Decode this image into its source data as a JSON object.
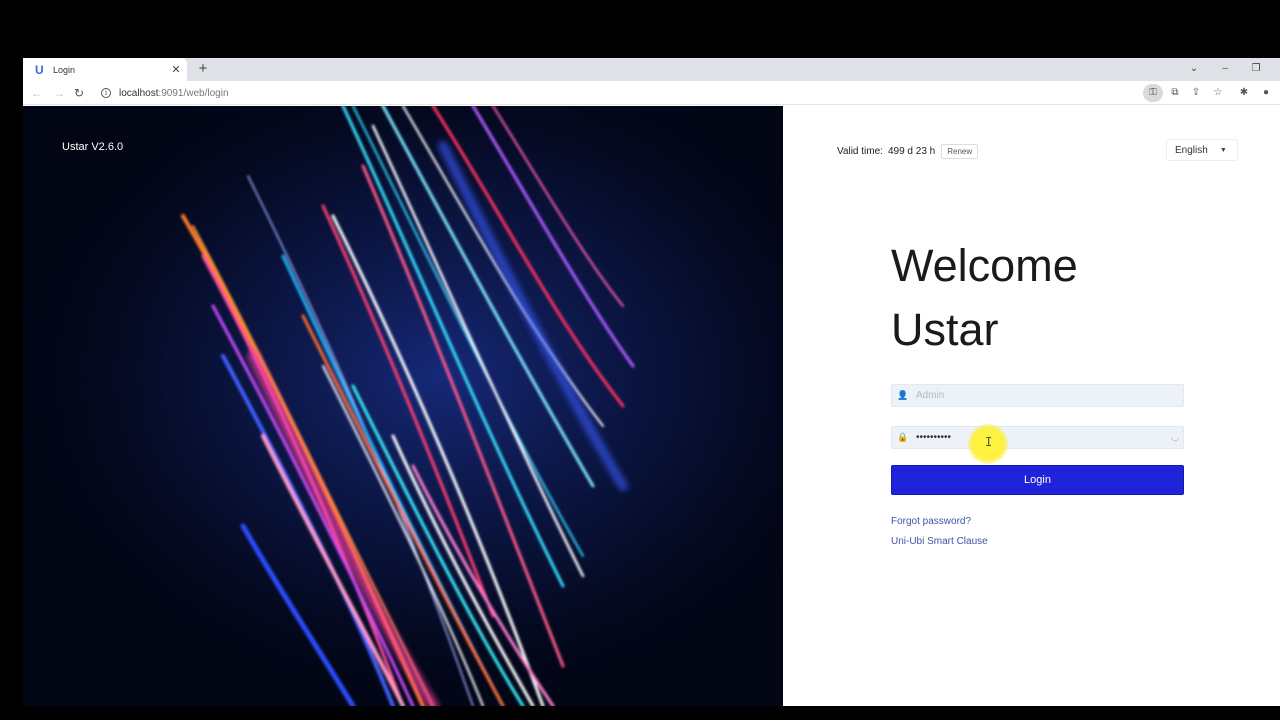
{
  "browser": {
    "tab": {
      "title": "Login",
      "favicon": "U"
    },
    "url": {
      "host": "localhost",
      "path": ":9091/web/login"
    },
    "icons": {
      "close": "✕",
      "newtab": "+",
      "tablist": "⌄",
      "minimize": "–",
      "restore": "❐",
      "back": "←",
      "forward": "→",
      "reload": "↻",
      "key": "⚿",
      "translate": "⧉",
      "share": "⇪",
      "star": "☆",
      "extensions": "✱",
      "profile": "●"
    }
  },
  "hero": {
    "version": "Ustar V2.6.0"
  },
  "panel": {
    "valid_label": "Valid time:",
    "valid_value": "499 d 23 h",
    "renew": "Renew",
    "language": "English",
    "welcome_line1": "Welcome",
    "welcome_line2": "Ustar",
    "username_placeholder": "Admin",
    "password_value": "••••••••••",
    "login": "Login",
    "forgot": "Forgot password?",
    "clause": "Uni-Ubi Smart Clause"
  },
  "colors": {
    "primary_button": "#1f24db",
    "link": "#3a58a4",
    "field_bg": "#edf2f9",
    "hero_bg": "#020514"
  }
}
